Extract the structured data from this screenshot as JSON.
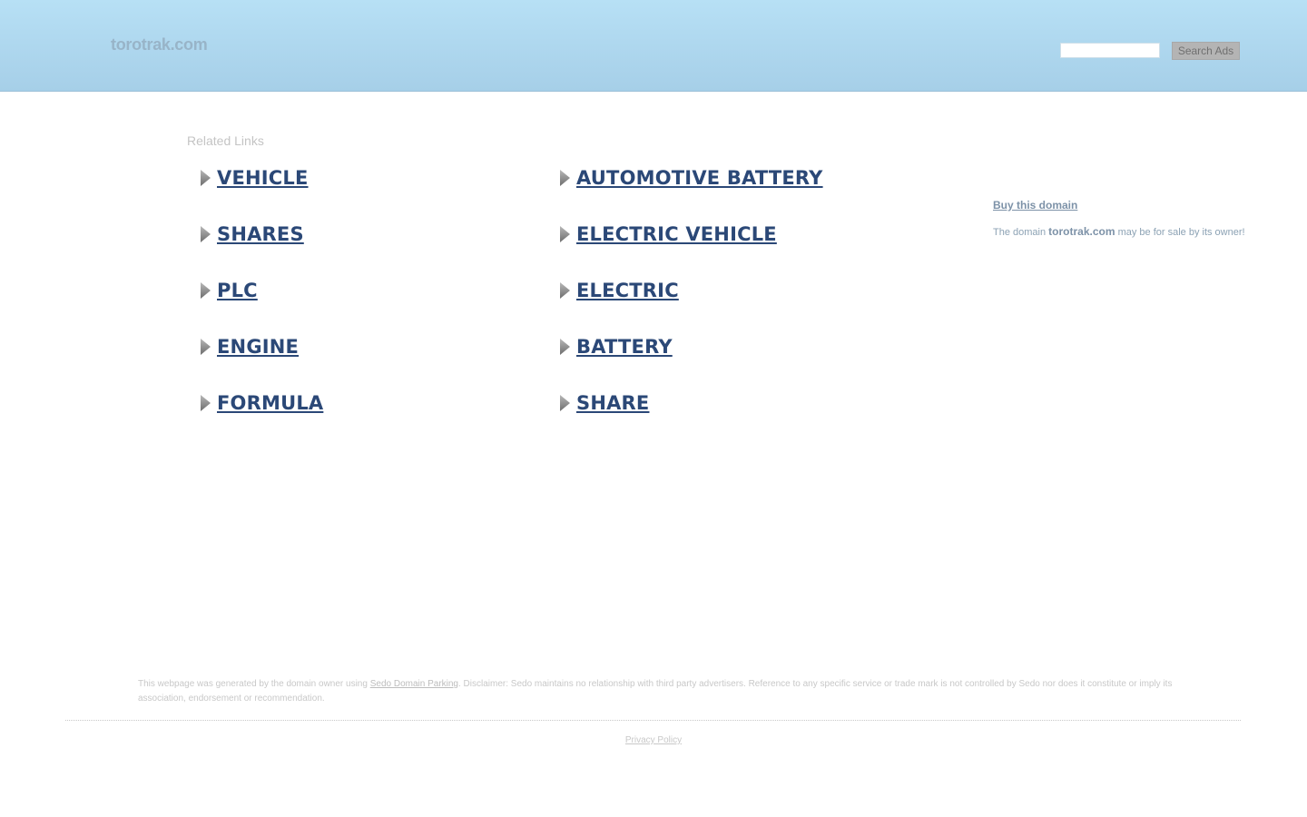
{
  "header": {
    "site_title": "torotrak.com",
    "search": {
      "value": "",
      "placeholder": ""
    },
    "search_button": "Search Ads"
  },
  "related": {
    "heading": "Related Links",
    "links": [
      "VEHICLE",
      "SHARES",
      "PLC",
      "ENGINE",
      "FORMULA",
      "AUTOMOTIVE BATTERY",
      "ELECTRIC VEHICLE",
      "ELECTRIC",
      "BATTERY",
      "SHARE"
    ],
    "arrow_icon": "triangle-right-icon"
  },
  "sidebar": {
    "buy_link": "Buy this domain",
    "note_prefix": "The domain ",
    "note_domain": "torotrak.com",
    "note_suffix": " may be for sale by its owner!"
  },
  "footer": {
    "disclaimer_prefix": "This webpage was generated by the domain owner using ",
    "sedo_link": "Sedo Domain Parking",
    "disclaimer_suffix": ". Disclaimer: Sedo maintains no relationship with third party advertisers. Reference to any specific service or trade mark is not controlled by Sedo nor does it constitute or imply its association, endorsement or recommendation.",
    "privacy_link": "Privacy Policy"
  },
  "colors": {
    "header_top": "#b7e0f5",
    "header_bottom": "#a6cfe8",
    "link": "#2b4877",
    "arrow": "#8c8c8c"
  }
}
